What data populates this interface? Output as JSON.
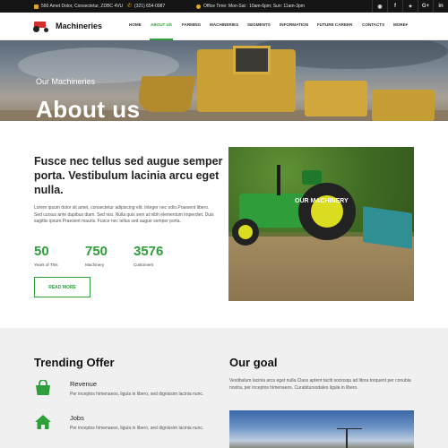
{
  "topbar": {
    "address": "560 Amet Dolor, Consectetur, ZDBC 4VU",
    "phone": "(321) 654-0987",
    "hours": "Office Time: Mon-Sat : 10am-6pm; Sun: 11am-3pm",
    "social": [
      "rss-icon",
      "facebook-icon",
      "twitter-icon",
      "google-plus-icon",
      "linkedin-icon"
    ]
  },
  "brand": {
    "name": "Machineries"
  },
  "nav": {
    "items": [
      "HOME",
      "ABOUT US",
      "FARMING",
      "MACHINERIES",
      "SEGMENTS",
      "INFORMATION",
      "FUTURE CAREER",
      "CONTACTS",
      "MORE"
    ],
    "active": "ABOUT US",
    "more_caret": "▾"
  },
  "hero": {
    "eyebrow": "Our Machineries",
    "title": "About us"
  },
  "about": {
    "heading": "Fusce nec tellus sed augue semper porta. Vestibulum lacinia arcu eget nulla.",
    "body": "Lorem ipsum dolor sit amet, consectetur adipiscing elit. Integer nec odio.Praesent libero. Sed cursus ante dapibus diam. Sed nisi. Nulla quis sem at nibh elementum imperdiet. Duis sagittis ipsum.Praesent mauris. Fusce nec tellus sed augue semper porta.",
    "stats": [
      {
        "value": "50",
        "label": "Years of This"
      },
      {
        "value": "750",
        "label": "Machinery"
      },
      {
        "value": "3576",
        "label": "Customers"
      }
    ],
    "read_more": "READ MORE",
    "image_caption": "OUR MACHINERY"
  },
  "trending": {
    "title": "Trending Offer",
    "items": [
      {
        "icon": "shopping-bag-icon",
        "name": "Revenue",
        "desc": "Per inceptos himenaeos, ligula in libero, sed dignissim lacinia nunc."
      },
      {
        "icon": "home-icon",
        "name": "Jobs",
        "desc": "Per inceptos himenaeos, ligula in libero, sed dignissim lacinia nunc."
      }
    ]
  },
  "goal": {
    "title": "Our goal",
    "text": "Vestibulum lacinia arcu eget nulla.Class aptent taciti sociosqu ad litora torquent per conubia nostra, per inceptos himenaeos. Curabitursodales ligula in libero."
  },
  "colors": {
    "accent": "#2e9e3a",
    "topbar_bg": "#151515",
    "topbar_icon": "#e3a623",
    "lower_bg": "#f0f0f0"
  }
}
